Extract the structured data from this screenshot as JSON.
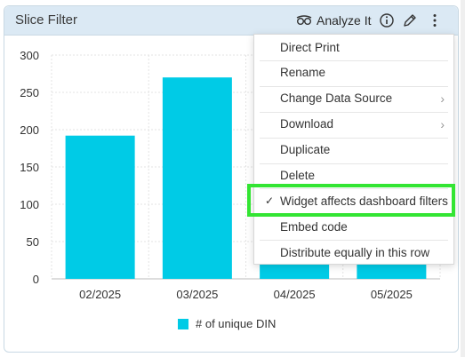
{
  "widget": {
    "title": "Slice Filter",
    "analyze_label": "Analyze It"
  },
  "menu": {
    "items": [
      {
        "label": "Direct Print",
        "submenu": false,
        "checked": false
      },
      {
        "label": "Rename",
        "submenu": false,
        "checked": false
      },
      {
        "label": "Change Data Source",
        "submenu": true,
        "checked": false
      },
      {
        "label": "Download",
        "submenu": true,
        "checked": false
      },
      {
        "label": "Duplicate",
        "submenu": false,
        "checked": false
      },
      {
        "label": "Delete",
        "submenu": false,
        "checked": false
      },
      {
        "label": "Widget affects dashboard filters",
        "submenu": false,
        "checked": true
      },
      {
        "label": "Embed code",
        "submenu": false,
        "checked": false
      },
      {
        "label": "Distribute equally in this row",
        "submenu": false,
        "checked": false
      }
    ],
    "chevron": "›",
    "check": "✓"
  },
  "colors": {
    "bar": "#00cbe6",
    "header_bg": "#dbe9f4",
    "highlight": "#33e533"
  },
  "chart_data": {
    "type": "bar",
    "categories": [
      "02/2025",
      "03/2025",
      "04/2025",
      "05/2025"
    ],
    "series": [
      {
        "name": "# of unique DIN",
        "values": [
          192,
          270,
          65,
          52
        ]
      }
    ],
    "ylim": [
      0,
      300
    ],
    "yticks": [
      0,
      50,
      100,
      150,
      200,
      250,
      300
    ],
    "grid": true,
    "legend": "bottom",
    "xlabel": "",
    "ylabel": "",
    "title": ""
  }
}
